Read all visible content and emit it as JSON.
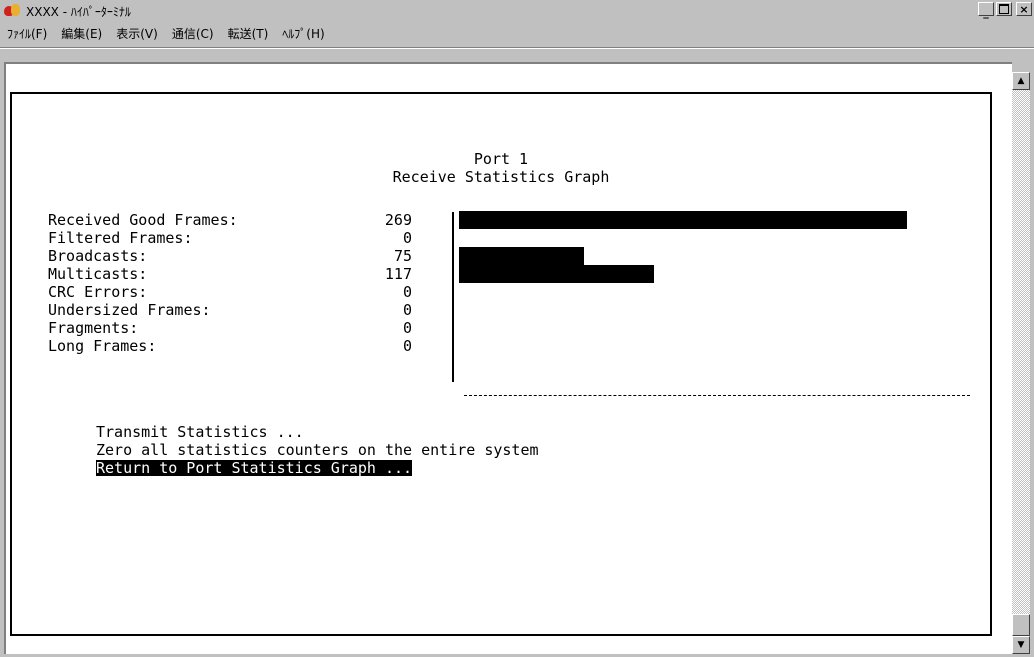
{
  "window": {
    "title": "XXXX - ﾊｲﾊﾟｰﾀｰﾐﾅﾙ",
    "controls": [
      "minimize",
      "maximize",
      "close"
    ]
  },
  "menubar": {
    "items": [
      "ﾌｧｲﾙ(F)",
      "編集(E)",
      "表示(V)",
      "通信(C)",
      "転送(T)",
      "ﾍﾙﾌﾟ(H)"
    ]
  },
  "terminal": {
    "heading_line1": "Port 1",
    "heading_line2": "Receive Statistics Graph",
    "stats": [
      {
        "label": "Received Good Frames:",
        "value": "269"
      },
      {
        "label": "Filtered Frames:",
        "value": "0"
      },
      {
        "label": "Broadcasts:",
        "value": "75"
      },
      {
        "label": "Multicasts:",
        "value": "117"
      },
      {
        "label": "CRC Errors:",
        "value": "0"
      },
      {
        "label": "Undersized Frames:",
        "value": "0"
      },
      {
        "label": "Fragments:",
        "value": "0"
      },
      {
        "label": "Long Frames:",
        "value": "0"
      }
    ],
    "options": [
      "Transmit Statistics ...",
      "Zero all statistics counters on the entire system",
      "Return to Port Statistics Graph ..."
    ],
    "selected_option": 2
  },
  "chart_data": {
    "type": "bar",
    "categories": [
      "Received Good Frames",
      "Filtered Frames",
      "Broadcasts",
      "Multicasts",
      "CRC Errors",
      "Undersized Frames",
      "Fragments",
      "Long Frames"
    ],
    "values": [
      269,
      0,
      75,
      117,
      0,
      0,
      0,
      0
    ],
    "orientation": "horizontal"
  }
}
